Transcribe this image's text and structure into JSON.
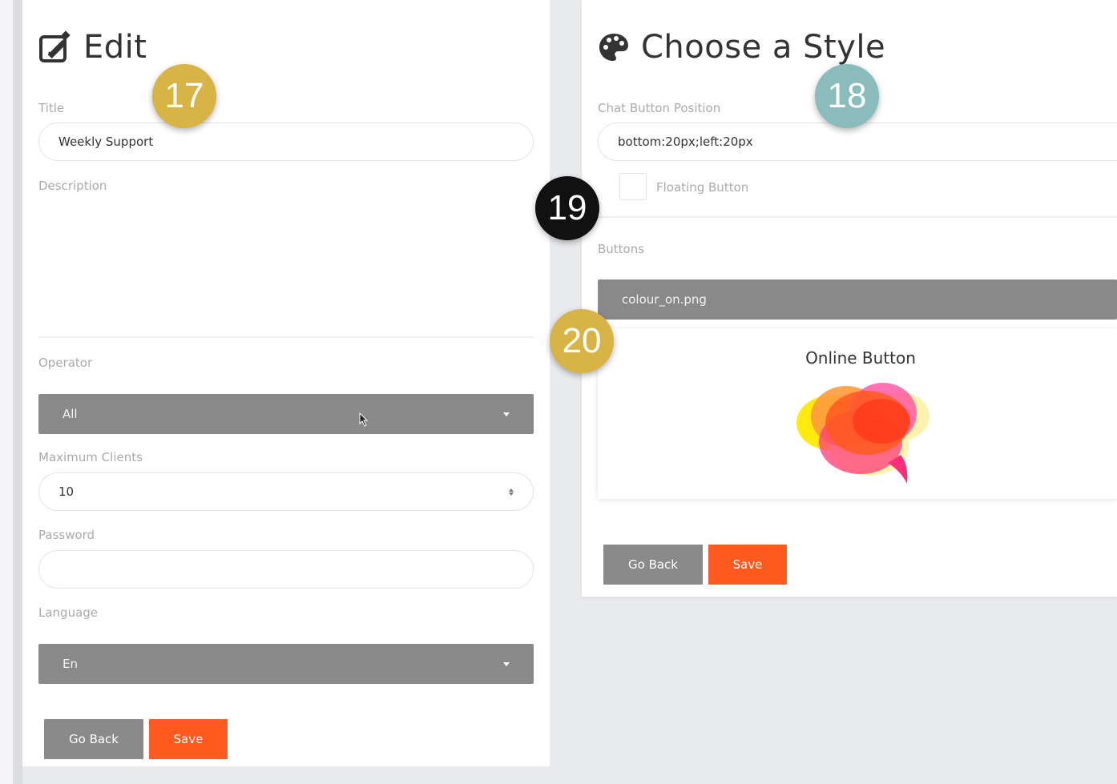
{
  "edit_panel": {
    "heading": "Edit",
    "heading_icon": "edit-icon",
    "title_label": "Title",
    "title_value": "Weekly Support",
    "description_label": "Description",
    "operator_label": "Operator",
    "operator_value": "All",
    "max_clients_label": "Maximum Clients",
    "max_clients_value": "10",
    "password_label": "Password",
    "password_value": "",
    "language_label": "Language",
    "language_value": "En",
    "go_back_label": "Go Back",
    "save_label": "Save"
  },
  "style_panel": {
    "heading": "Choose a Style",
    "heading_icon": "palette-icon",
    "position_label": "Chat Button Position",
    "position_value": "bottom:20px;left:20px",
    "floating_label": "Floating Button",
    "floating_checked": false,
    "buttons_label": "Buttons",
    "buttons_value": "colour_on.png",
    "preview_title": "Online Button",
    "preview_icon": "chat-bubble-icon",
    "go_back_label": "Go Back",
    "save_label": "Save"
  },
  "badges": [
    {
      "number": "17",
      "color": "#d7b445"
    },
    {
      "number": "18",
      "color": "#8bbcbc"
    },
    {
      "number": "19",
      "color": "#111111"
    },
    {
      "number": "20",
      "color": "#d7b445"
    }
  ],
  "colors": {
    "accent_orange": "#ff5a1f",
    "button_gray": "#8a8a8a",
    "background": "#e9eaed"
  }
}
